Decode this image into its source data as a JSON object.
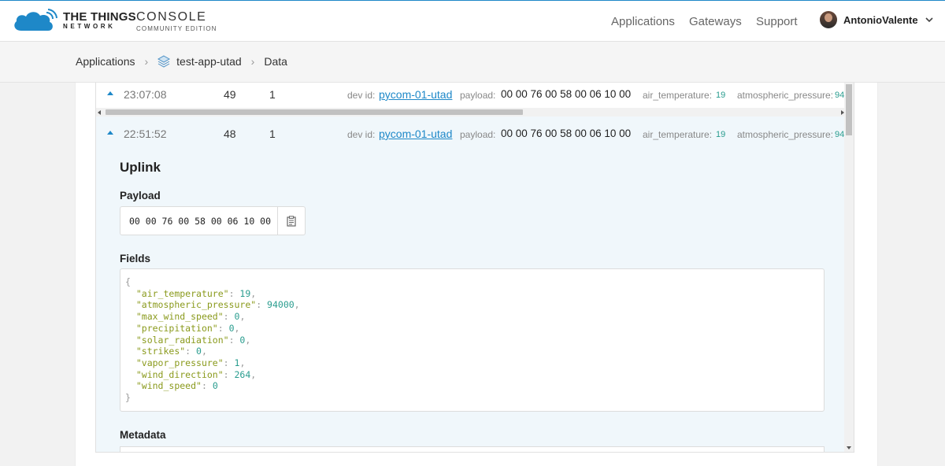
{
  "header": {
    "brand_main": "THE THINGS",
    "brand_sub": "NETWORK",
    "console_main": "CONSOLE",
    "console_sub": "COMMUNITY EDITION",
    "nav": [
      "Applications",
      "Gateways",
      "Support"
    ],
    "username": "AntonioValente"
  },
  "breadcrumb": {
    "items": [
      "Applications",
      "test-app-utad",
      "Data"
    ]
  },
  "rows": [
    {
      "time": "23:07:08",
      "counter": "49",
      "port": "1",
      "dev_label": "dev id:",
      "dev_id": "pycom-01-utad",
      "payload_label": "payload:",
      "payload": "00 00 76 00 58 00 06 10 00",
      "air_label": "air_temperature:",
      "air_value": "19",
      "atm_label": "atmospheric_pressure:",
      "atm_value": "94"
    },
    {
      "time": "22:51:52",
      "counter": "48",
      "port": "1",
      "dev_label": "dev id:",
      "dev_id": "pycom-01-utad",
      "payload_label": "payload:",
      "payload": "00 00 76 00 58 00 06 10 00",
      "air_label": "air_temperature:",
      "air_value": "19",
      "atm_label": "atmospheric_pressure:",
      "atm_value": "94"
    }
  ],
  "detail": {
    "title": "Uplink",
    "payload_heading": "Payload",
    "payload_hex": "00 00 76 00 58 00 06 10 00",
    "fields_heading": "Fields",
    "fields": [
      {
        "key": "air_temperature",
        "value": "19"
      },
      {
        "key": "atmospheric_pressure",
        "value": "94000"
      },
      {
        "key": "max_wind_speed",
        "value": "0"
      },
      {
        "key": "precipitation",
        "value": "0"
      },
      {
        "key": "solar_radiation",
        "value": "0"
      },
      {
        "key": "strikes",
        "value": "0"
      },
      {
        "key": "vapor_pressure",
        "value": "1"
      },
      {
        "key": "wind_direction",
        "value": "264"
      },
      {
        "key": "wind_speed",
        "value": "0"
      }
    ],
    "metadata_heading": "Metadata"
  },
  "icons": {
    "logo": "ttn-cloud-logo",
    "app": "layers-icon",
    "copy": "clipboard-icon",
    "dropdown": "chevron-down-icon"
  },
  "colors": {
    "accent": "#1e88c8",
    "json_key": "#8a9a1c",
    "json_number": "#2a9d8f"
  }
}
